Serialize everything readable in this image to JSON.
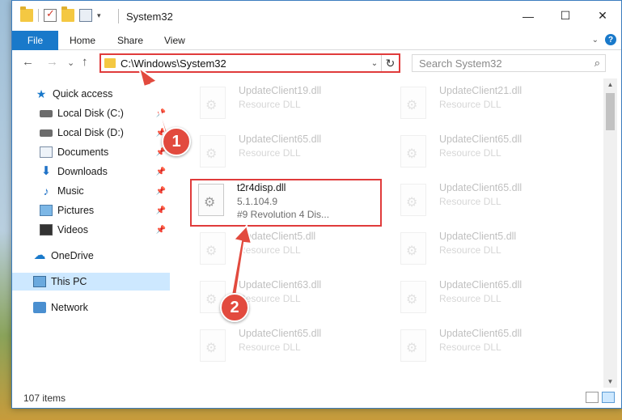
{
  "window": {
    "title": "System32",
    "controls": {
      "minimize": "—",
      "maximize": "☐",
      "close": "✕"
    }
  },
  "ribbon": {
    "tabs": [
      "File",
      "Home",
      "Share",
      "View"
    ],
    "help": "?",
    "collapse": "⌄"
  },
  "navigation": {
    "back": "←",
    "forward": "→",
    "recent": "⌄",
    "up": "↑",
    "address": "C:\\Windows\\System32",
    "address_dropdown": "⌄",
    "refresh": "↻",
    "search_placeholder": "Search System32",
    "search_icon": "⌕"
  },
  "sidebar": {
    "items": [
      {
        "label": "Quick access",
        "icon": "star-icon",
        "pinned": false
      },
      {
        "label": "Local Disk (C:)",
        "icon": "disk-icon",
        "pinned": true
      },
      {
        "label": "Local Disk (D:)",
        "icon": "disk-icon",
        "pinned": true
      },
      {
        "label": "Documents",
        "icon": "document-icon",
        "pinned": true
      },
      {
        "label": "Downloads",
        "icon": "download-icon",
        "pinned": true
      },
      {
        "label": "Music",
        "icon": "music-icon",
        "pinned": true
      },
      {
        "label": "Pictures",
        "icon": "pictures-icon",
        "pinned": true
      },
      {
        "label": "Videos",
        "icon": "videos-icon",
        "pinned": true
      },
      {
        "label": "OneDrive",
        "icon": "cloud-icon",
        "pinned": false
      },
      {
        "label": "This PC",
        "icon": "computer-icon",
        "pinned": false,
        "selected": true
      },
      {
        "label": "Network",
        "icon": "network-icon",
        "pinned": false
      }
    ],
    "pin_glyph": "📌"
  },
  "files": [
    {
      "name": "UpdateClient19.dll",
      "type": "Resource DLL"
    },
    {
      "name": "UpdateClient21.dll",
      "type": "Resource DLL"
    },
    {
      "name": "UpdateClient65.dll",
      "type": "Resource DLL"
    },
    {
      "name": "UpdateClient65.dll",
      "type": "Resource DLL"
    },
    {
      "name": "UpdateClient65.dll",
      "type": "Resource DLL"
    },
    {
      "name": "UpdateClient5.dll",
      "type": "Resource DLL"
    },
    {
      "name": "UpdateClient5.dll",
      "type": "Resource DLL"
    },
    {
      "name": "UpdateClient63.dll",
      "type": "Resource DLL"
    },
    {
      "name": "UpdateClient65.dll",
      "type": "Resource DLL"
    },
    {
      "name": "UpdateClient65.dll",
      "type": "Resource DLL"
    },
    {
      "name": "UpdateClient65.dll",
      "type": "Resource DLL"
    }
  ],
  "highlighted_file": {
    "name": "t2r4disp.dll",
    "version": "5.1.104.9",
    "description": "#9 Revolution 4 Dis..."
  },
  "status": {
    "item_count": "107 items"
  },
  "annotations": {
    "step1": "1",
    "step2": "2"
  },
  "colors": {
    "accent": "#1979ca",
    "highlight": "#e03b3b",
    "selected_bg": "#cde8ff"
  }
}
